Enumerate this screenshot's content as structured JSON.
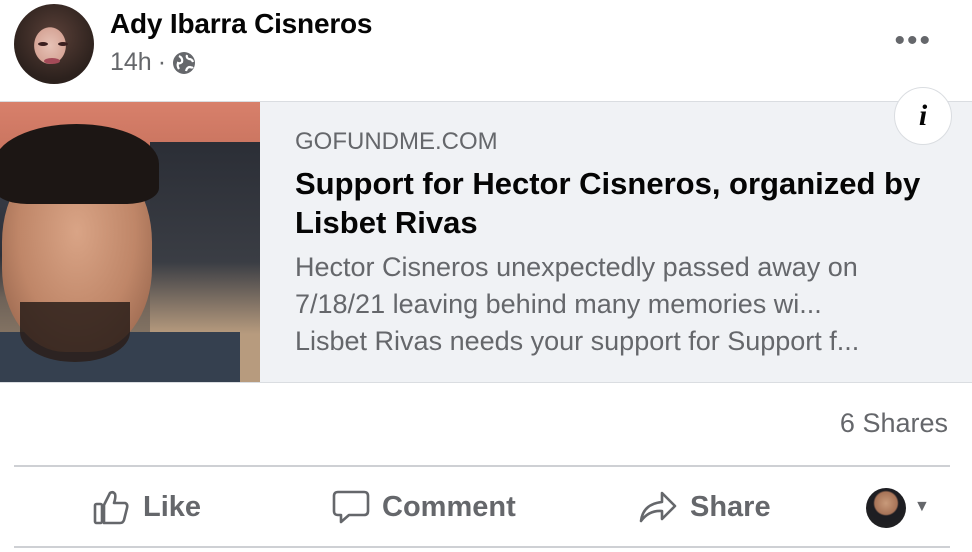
{
  "post": {
    "author": "Ady Ibarra Cisneros",
    "time": "14h",
    "separator": "·",
    "audience_icon": "globe-icon",
    "more_label": "•••"
  },
  "link": {
    "domain": "GOFUNDME.COM",
    "title": "Support for Hector Cisneros, organized by Lisbet Rivas",
    "desc_line1": "Hector Cisneros unexpectedly passed away on",
    "desc_line2": "7/18/21 leaving behind many memories wi...",
    "desc_line3": "Lisbet Rivas needs your support for Support f...",
    "info_label": "i"
  },
  "stats": {
    "shares": "6 Shares"
  },
  "actions": {
    "like": "Like",
    "comment": "Comment",
    "share": "Share",
    "caret": "▼"
  },
  "colors": {
    "secondary_text": "#65676b",
    "card_bg": "#f0f2f5",
    "divider": "#ced0d4"
  }
}
